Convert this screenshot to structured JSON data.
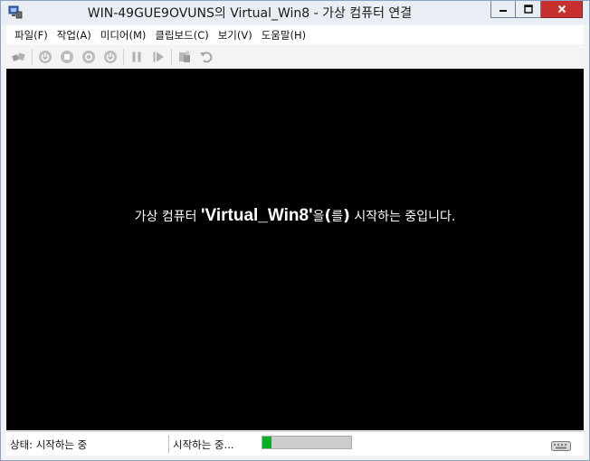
{
  "window": {
    "title": "WIN-49GUE9OVUNS의 Virtual_Win8 - 가상 컴퓨터 연결",
    "controls": {
      "minimize": "minimize-icon",
      "maximize": "maximize-icon",
      "close": "close-icon"
    }
  },
  "menu": [
    {
      "label": "파일(F)"
    },
    {
      "label": "작업(A)"
    },
    {
      "label": "미디어(M)"
    },
    {
      "label": "클립보드(C)"
    },
    {
      "label": "보기(V)"
    },
    {
      "label": "도움말(H)"
    }
  ],
  "toolbar": {
    "icons": [
      "ctrl-alt-del-icon",
      "start-icon",
      "turn-off-icon",
      "shut-down-icon",
      "save-icon",
      "pause-icon",
      "reset-icon",
      "snapshot-icon",
      "revert-icon"
    ]
  },
  "screen": {
    "prefix": "가상 컴퓨터 ",
    "vm_name": "'Virtual_Win8'",
    "particle_a": "을",
    "paren_open": "(",
    "particle_b": "를",
    "paren_close": ")",
    "suffix": " 시작하는 중입니다."
  },
  "status": {
    "left": "상태: 시작하는 중",
    "middle": "시작하는 중...",
    "progress_fraction": 0.1
  },
  "colors": {
    "progress": "#06b025",
    "screen": "#000000",
    "close_button": "#c7302f"
  }
}
